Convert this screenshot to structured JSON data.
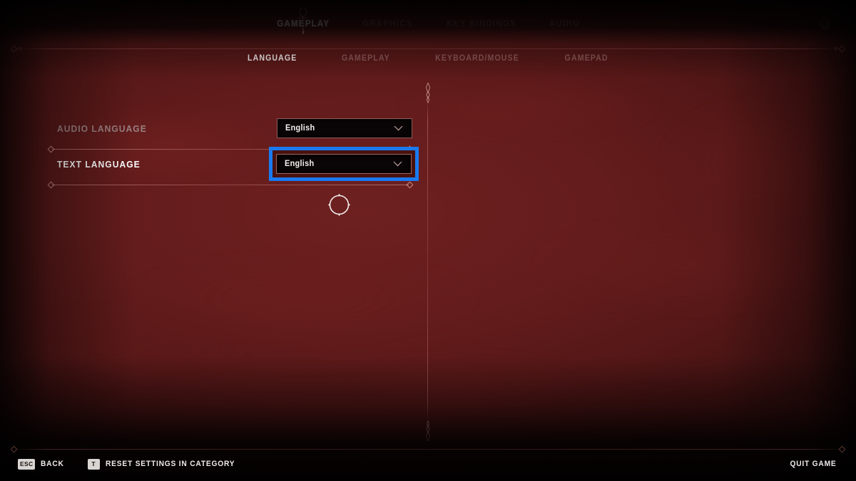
{
  "theme": {
    "background": "#641c1c",
    "accent_highlight": "#1a7af0",
    "text_active": "#f4efee",
    "text_inactive": "#7d4d4d",
    "label_dim": "#9b8183",
    "dropdown_background": "#0a0506",
    "dropdown_border": "#8b5b58"
  },
  "header": {
    "gear_icon": "gear-icon",
    "active_marker_icon": "ankh-ornament-icon",
    "tabs": [
      {
        "label": "GAMEPLAY",
        "active": true
      },
      {
        "label": "GRAPHICS",
        "active": false
      },
      {
        "label": "KEY BINDINGS",
        "active": false
      },
      {
        "label": "AUDIO",
        "active": false
      }
    ]
  },
  "sub_nav": {
    "tabs": [
      {
        "label": "LANGUAGE",
        "active": true
      },
      {
        "label": "GAMEPLAY",
        "active": false
      },
      {
        "label": "KEYBOARD/MOUSE",
        "active": false
      },
      {
        "label": "GAMEPAD",
        "active": false
      }
    ]
  },
  "settings": {
    "rows": [
      {
        "label": "AUDIO LANGUAGE",
        "value": "English",
        "control": "dropdown",
        "chevron_icon": "chevron-down-icon",
        "selected": false,
        "dimmed": true
      },
      {
        "label": "TEXT LANGUAGE",
        "value": "English",
        "control": "dropdown",
        "chevron_icon": "chevron-down-icon",
        "selected": true,
        "dimmed": false
      }
    ]
  },
  "cursor": {
    "icon": "circle-cursor-icon"
  },
  "footer": {
    "hints": [
      {
        "key": "ESC",
        "label": "BACK"
      },
      {
        "key": "T",
        "label": "RESET SETTINGS IN CATEGORY"
      }
    ],
    "quit_label": "QUIT GAME"
  }
}
